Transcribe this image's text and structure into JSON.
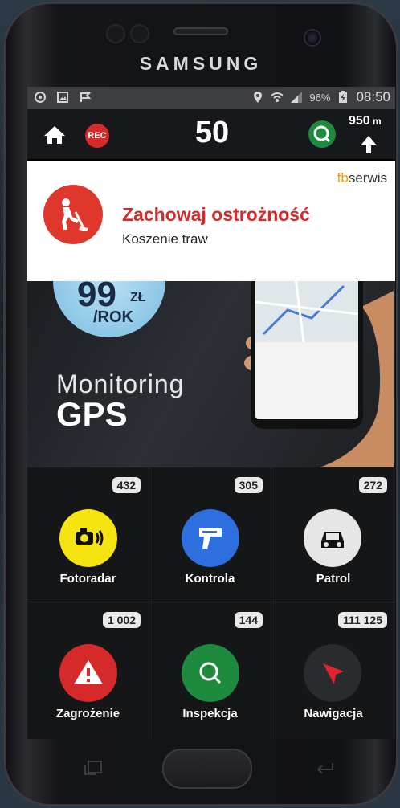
{
  "device": {
    "brand": "SAMSUNG"
  },
  "status_bar": {
    "battery": "96%",
    "time": "08:50"
  },
  "top_bar": {
    "rec_label": "REC",
    "speed": "50",
    "distance": "950",
    "distance_unit": "m"
  },
  "alert": {
    "title": "Zachowaj ostrożność",
    "subtitle": "Koszenie traw",
    "brand_prefix": "fb",
    "brand_suffix": "serwis"
  },
  "banner": {
    "price": "99",
    "currency": "ZŁ",
    "period": "/ROK",
    "line1": "Monitoring",
    "line2": "GPS"
  },
  "grid": {
    "items": [
      {
        "label": "Fotoradar",
        "count": "432",
        "icon": "speed-camera-icon",
        "color": "#f6e312"
      },
      {
        "label": "Kontrola",
        "count": "305",
        "icon": "radar-gun-icon",
        "color": "#2e6fe0"
      },
      {
        "label": "Patrol",
        "count": "272",
        "icon": "police-car-icon",
        "color": "#e6e6e6"
      },
      {
        "label": "Zagrożenie",
        "count": "1 002",
        "icon": "warning-icon",
        "color": "#d62a2a"
      },
      {
        "label": "Inspekcja",
        "count": "144",
        "icon": "inspection-icon",
        "color": "#1e8a3e"
      },
      {
        "label": "Nawigacja",
        "count": "111 125",
        "icon": "navigation-arrow-icon",
        "color": "#2a2b2f"
      }
    ]
  }
}
